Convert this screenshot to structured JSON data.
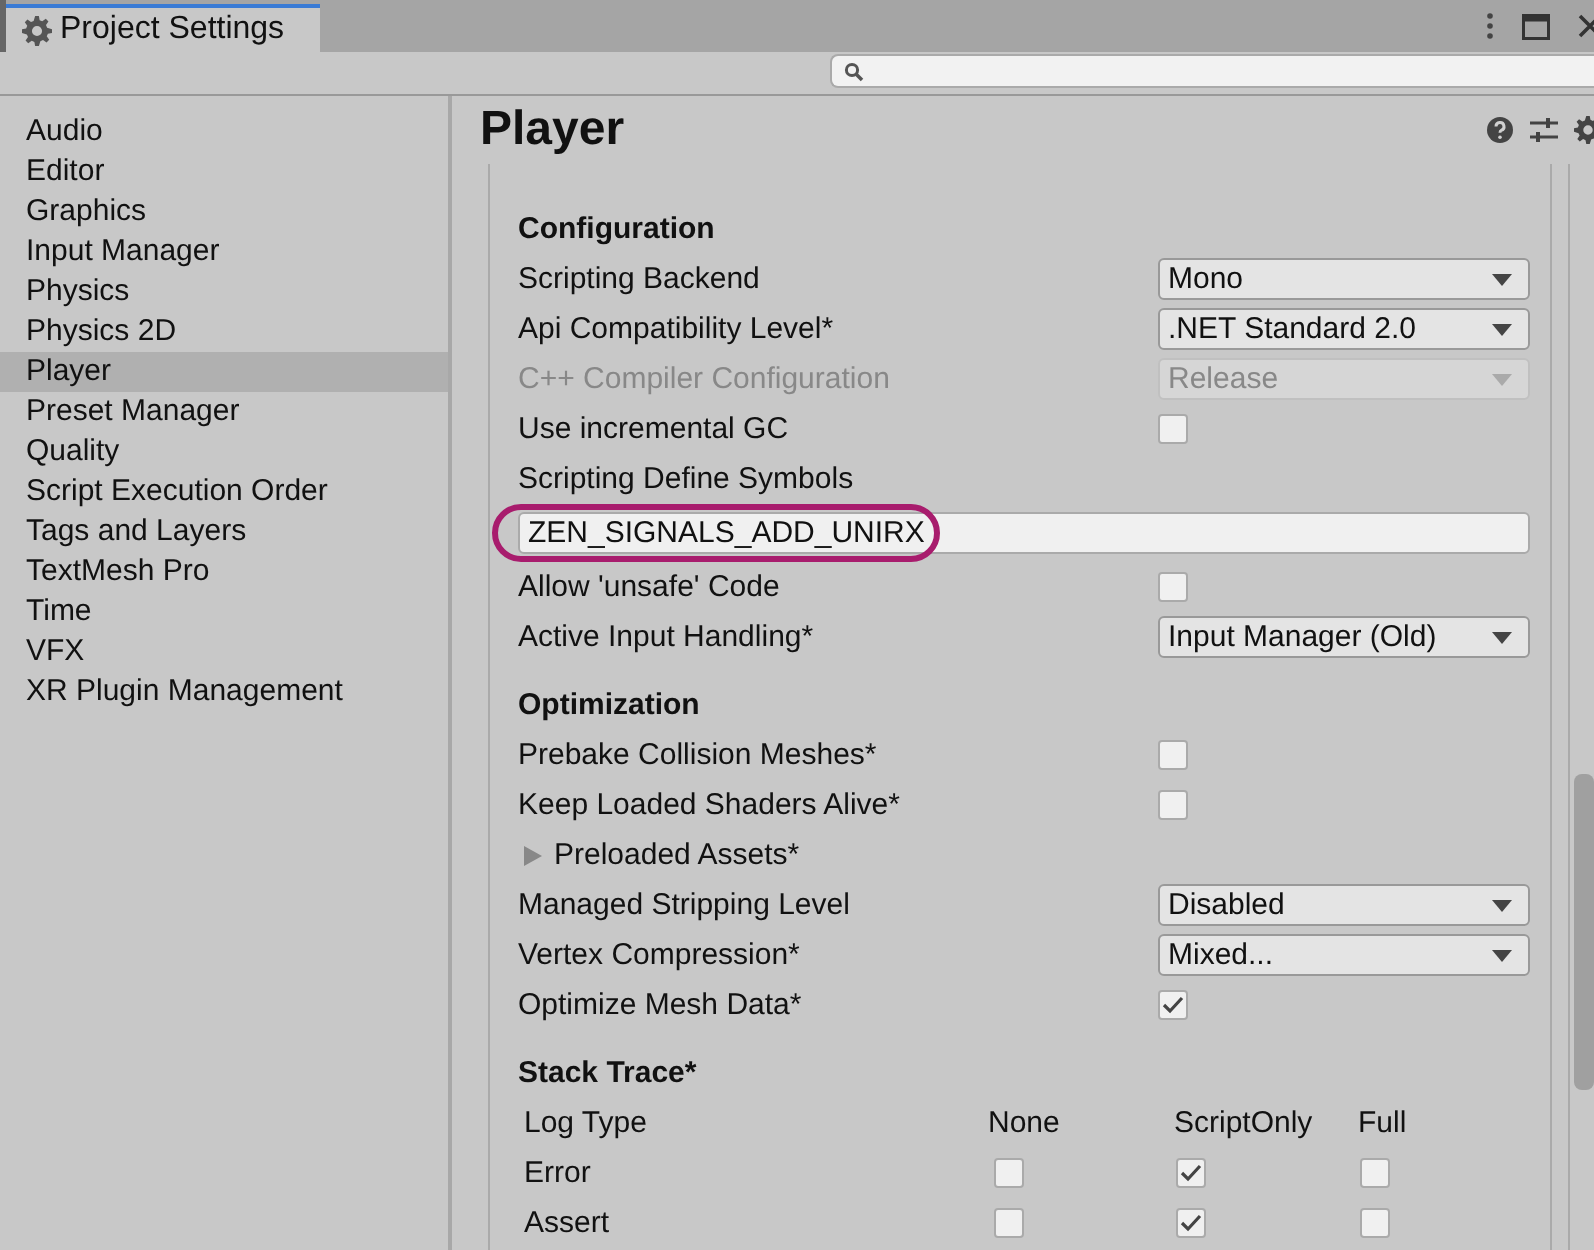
{
  "window": {
    "title": "Project Settings"
  },
  "sidebar": {
    "items": [
      {
        "label": "Audio",
        "selected": false
      },
      {
        "label": "Editor",
        "selected": false
      },
      {
        "label": "Graphics",
        "selected": false
      },
      {
        "label": "Input Manager",
        "selected": false
      },
      {
        "label": "Physics",
        "selected": false
      },
      {
        "label": "Physics 2D",
        "selected": false
      },
      {
        "label": "Player",
        "selected": true
      },
      {
        "label": "Preset Manager",
        "selected": false
      },
      {
        "label": "Quality",
        "selected": false
      },
      {
        "label": "Script Execution Order",
        "selected": false
      },
      {
        "label": "Tags and Layers",
        "selected": false
      },
      {
        "label": "TextMesh Pro",
        "selected": false
      },
      {
        "label": "Time",
        "selected": false
      },
      {
        "label": "VFX",
        "selected": false
      },
      {
        "label": "XR Plugin Management",
        "selected": false
      }
    ]
  },
  "panel": {
    "title": "Player",
    "rows": [
      {
        "kind": "header",
        "label": "Configuration"
      },
      {
        "kind": "dropdown",
        "label": "Scripting Backend",
        "value": "Mono",
        "disabled": false
      },
      {
        "kind": "dropdown",
        "label": "Api Compatibility Level*",
        "value": ".NET Standard 2.0",
        "disabled": false
      },
      {
        "kind": "dropdown",
        "label": "C++ Compiler Configuration",
        "value": "Release",
        "disabled": true
      },
      {
        "kind": "checkbox",
        "label": "Use incremental GC",
        "checked": false
      },
      {
        "kind": "label",
        "label": "Scripting Define Symbols"
      },
      {
        "kind": "textfield",
        "value": "ZEN_SIGNALS_ADD_UNIRX",
        "highlighted": true
      },
      {
        "kind": "checkbox",
        "label": "Allow 'unsafe' Code",
        "checked": false
      },
      {
        "kind": "dropdown",
        "label": "Active Input Handling*",
        "value": "Input Manager (Old)",
        "disabled": false
      },
      {
        "kind": "header",
        "label": "Optimization"
      },
      {
        "kind": "checkbox",
        "label": "Prebake Collision Meshes*",
        "checked": false
      },
      {
        "kind": "checkbox",
        "label": "Keep Loaded Shaders Alive*",
        "checked": false
      },
      {
        "kind": "foldout",
        "label": "Preloaded Assets*",
        "expanded": false
      },
      {
        "kind": "dropdown",
        "label": "Managed Stripping Level",
        "value": "Disabled",
        "disabled": false
      },
      {
        "kind": "dropdown",
        "label": "Vertex Compression*",
        "value": "Mixed...",
        "disabled": false
      },
      {
        "kind": "checkbox",
        "label": "Optimize Mesh Data*",
        "checked": true
      },
      {
        "kind": "header",
        "label": "Stack Trace*"
      }
    ],
    "stack_trace": {
      "columns": [
        "Log Type",
        "None",
        "ScriptOnly",
        "Full"
      ],
      "rows": [
        {
          "label": "Error",
          "options": [
            {
              "selected": false
            },
            {
              "selected": true
            },
            {
              "selected": false
            }
          ]
        },
        {
          "label": "Assert",
          "options": [
            {
              "selected": false
            },
            {
              "selected": true
            },
            {
              "selected": false
            }
          ]
        }
      ]
    }
  }
}
